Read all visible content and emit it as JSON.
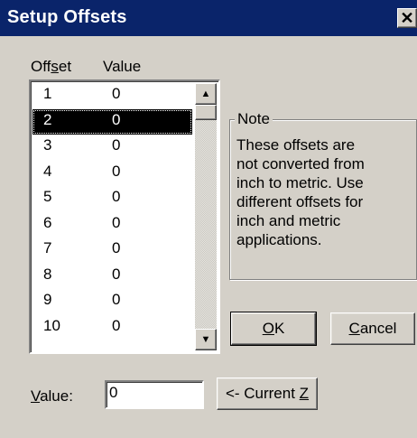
{
  "window": {
    "title": "Setup Offsets",
    "close_glyph": "✕",
    "close_icon": "close-icon"
  },
  "labels": {
    "offset_pre": "Off",
    "offset_u": "s",
    "offset_post": "et",
    "value_col": "Value"
  },
  "list": {
    "rows": [
      {
        "offset": "1",
        "value": "0"
      },
      {
        "offset": "2",
        "value": "0"
      },
      {
        "offset": "3",
        "value": "0"
      },
      {
        "offset": "4",
        "value": "0"
      },
      {
        "offset": "5",
        "value": "0"
      },
      {
        "offset": "6",
        "value": "0"
      },
      {
        "offset": "7",
        "value": "0"
      },
      {
        "offset": "8",
        "value": "0"
      },
      {
        "offset": "9",
        "value": "0"
      },
      {
        "offset": "10",
        "value": "0"
      }
    ],
    "selected_offset": "2",
    "scroll_up_icon": "scroll-up-arrow-icon",
    "scroll_down_icon": "scroll-down-arrow-icon"
  },
  "note": {
    "legend": "Note",
    "text": "These offsets are\nnot converted from\ninch to metric.  Use\ndifferent offsets for\ninch and metric\napplications."
  },
  "buttons": {
    "ok_u": "O",
    "ok_rest": "K",
    "cancel_u": "C",
    "cancel_rest": "ancel",
    "current_pre": "<- Current ",
    "current_u": "Z"
  },
  "value_field": {
    "label_u": "V",
    "label_rest": "alue:",
    "value": "0"
  }
}
